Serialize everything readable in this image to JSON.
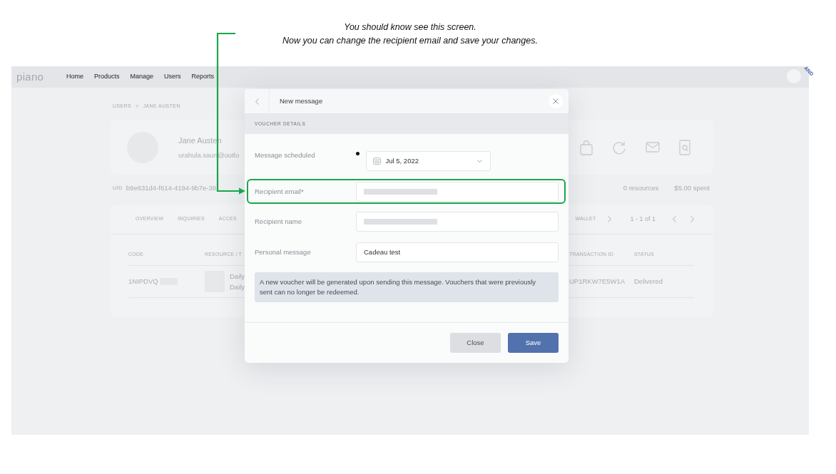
{
  "annotation": {
    "caption": [
      "You should know see this screen.",
      "Now you can change the recipient email and save your changes."
    ]
  },
  "app": {
    "logo": "piano",
    "nav": [
      "Home",
      "Products",
      "Manage",
      "Users",
      "Reports"
    ],
    "ribbon": "AND",
    "breadcrumb": [
      "USERS",
      ">",
      "JANE AUSTEN"
    ],
    "profile": {
      "name": "Jane Austen",
      "email": "urahula.saun@outlo"
    },
    "uid": {
      "label": "UID",
      "value": "b9e631d4-f614-4194-9b7e-38"
    },
    "stats": [
      "0 resources",
      "$5.00 spent"
    ],
    "tabs": [
      "OVERVIEW",
      "INQUIRIES",
      "ACCES"
    ],
    "wallet": {
      "label": "WALLET",
      "range": "1 - 1 of 1"
    },
    "table": {
      "columns": [
        "CODE",
        "RESOURCE / T",
        "TRANSACTION ID",
        "STATUS"
      ],
      "rows": [
        {
          "code": "1NIPDVQ",
          "resource_lines": [
            "Daily",
            "Daily"
          ],
          "transaction_id": "UP1RKW7E5W1A",
          "status": "Delivered"
        }
      ]
    }
  },
  "dialog": {
    "title": "New message",
    "section": "VOUCHER DETAILS",
    "fields": [
      {
        "kind": "schedule",
        "label": "Message scheduled",
        "selected": true,
        "value": "Jul 5, 2022",
        "highlighted": false
      },
      {
        "kind": "redacted",
        "label": "Recipient email*",
        "highlighted": true
      },
      {
        "kind": "redacted",
        "label": "Recipient name",
        "highlighted": false
      },
      {
        "kind": "text",
        "label": "Personal message",
        "value": "Cadeau test",
        "highlighted": false
      }
    ],
    "notice": "A new voucher will be generated upon sending this message. Vouchers that were previously sent can no longer be redeemed.",
    "buttons": [
      {
        "kind": "secondary",
        "label": "Close"
      },
      {
        "kind": "primary",
        "label": "Save"
      }
    ]
  }
}
